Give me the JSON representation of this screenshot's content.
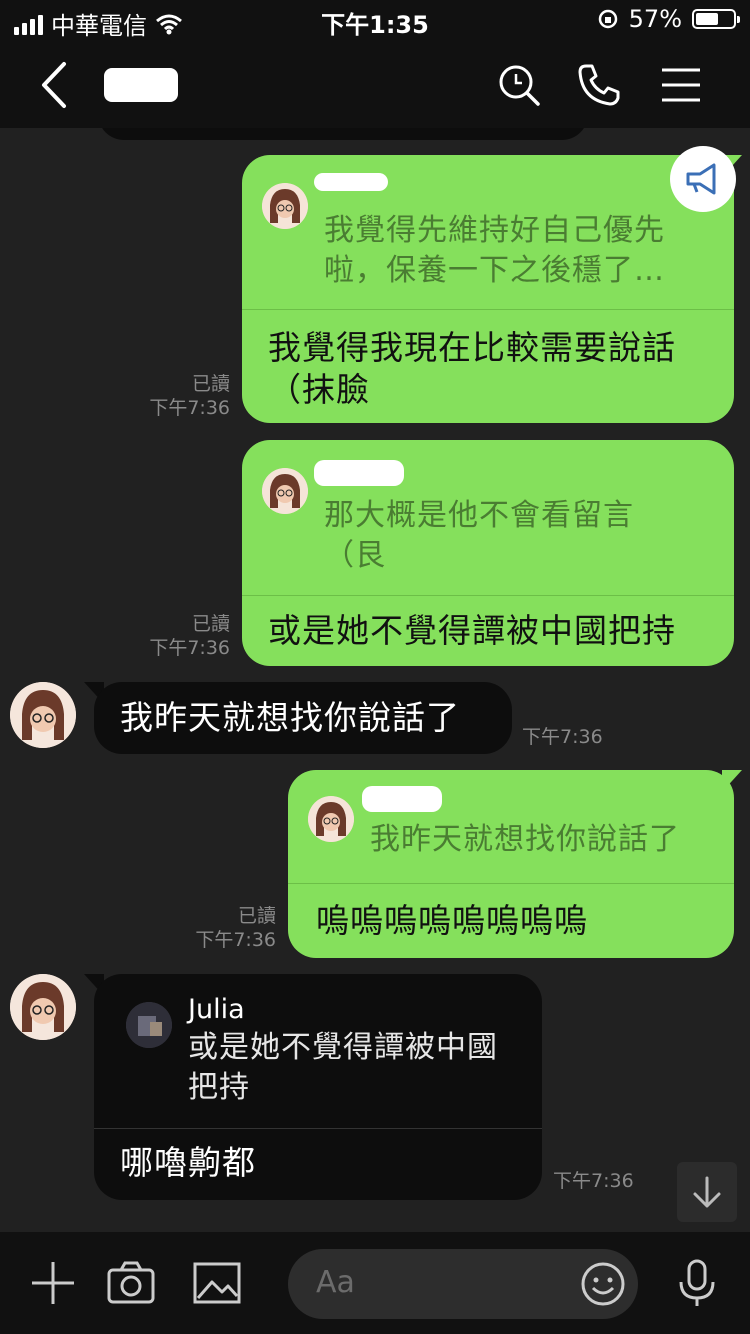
{
  "status_bar": {
    "carrier": "中華電信",
    "time": "下午1:35",
    "battery": "57%"
  },
  "header": {
    "icons": [
      "back-icon",
      "search-icon",
      "phone-icon",
      "menu-icon"
    ]
  },
  "messages": [
    {
      "quote": "我覺得先維持好自己優先啦，保養一下之後穩了…",
      "quote_line1": "我覺得先維持好自己優先",
      "quote_line2": "啦，保養一下之後穩了…",
      "text_line1": "我覺得我現在比較需要說話",
      "text_line2": "（抹臉",
      "read": "已讀",
      "time": "下午7:36"
    },
    {
      "quote_line1": "那大概是他不會看留言",
      "quote_line2": "（艮",
      "text": "或是她不覺得譚被中國把持",
      "read": "已讀",
      "time": "下午7:36"
    },
    {
      "text": "我昨天就想找你說話了",
      "time": "下午7:36"
    },
    {
      "quote": "我昨天就想找你說話了",
      "text": "嗚嗚嗚嗚嗚嗚嗚嗚",
      "read": "已讀",
      "time": "下午7:36"
    },
    {
      "quote_author": "Julia",
      "quote_line1": "或是她不覺得譚被中國",
      "quote_line2": "把持",
      "text": "哪嚕齁都",
      "time": "下午7:36"
    }
  ],
  "input": {
    "placeholder": "Aa"
  },
  "colors": {
    "green_bubble": "#85e05c",
    "dark_bubble": "#0d0d0d",
    "background": "#212121"
  }
}
